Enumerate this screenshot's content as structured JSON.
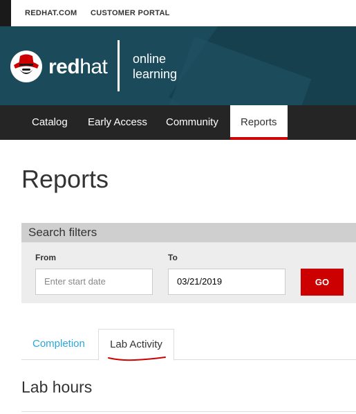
{
  "utility": {
    "links": [
      "REDHAT.COM",
      "CUSTOMER PORTAL"
    ]
  },
  "brand": {
    "name_bold": "red",
    "name_light": "hat",
    "product_line1": "online",
    "product_line2": "learning"
  },
  "nav": {
    "items": [
      "Catalog",
      "Early Access",
      "Community",
      "Reports"
    ],
    "active": "Reports"
  },
  "page": {
    "title": "Reports"
  },
  "filters": {
    "heading": "Search filters",
    "from_label": "From",
    "from_placeholder": "Enter start date",
    "to_label": "To",
    "to_value": "03/21/2019",
    "go_label": "GO"
  },
  "tabs": {
    "items": [
      "Completion",
      "Lab Activity"
    ],
    "active": "Lab Activity"
  },
  "section": {
    "heading": "Lab hours"
  },
  "colors": {
    "accent": "#cc0000",
    "link": "#2aa6d8",
    "hero": "#1b4a5a",
    "nav": "#252525"
  }
}
